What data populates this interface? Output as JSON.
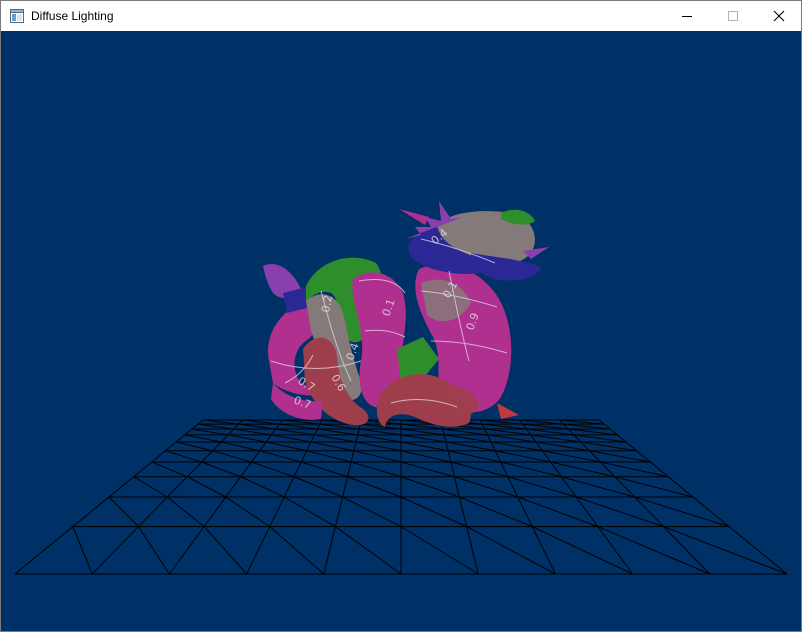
{
  "window": {
    "title": "Diffuse Lighting",
    "controls": {
      "minimize": "minimize-icon",
      "maximize": "maximize-icon",
      "close": "close-icon"
    }
  },
  "scene": {
    "background_color": "#003166",
    "grid_color": "#000000",
    "model": "dragon",
    "floor": "wireframe-grid",
    "uv_labels": [
      "0.1",
      "0.2",
      "0.4",
      "0.6",
      "0.7",
      "0.1",
      "0.9",
      "0.4",
      "0.7"
    ],
    "colors": {
      "magenta": "#b0308f",
      "green": "#2f8e2c",
      "gray": "#857a7a",
      "blue": "#2b2896",
      "red": "#9e3e4c",
      "violet": "#8a3fae"
    }
  }
}
